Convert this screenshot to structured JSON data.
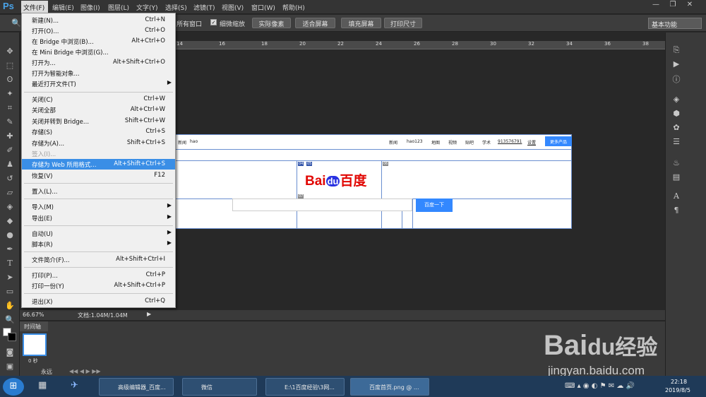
{
  "app": {
    "logo": "Ps"
  },
  "menubar": {
    "items": [
      "文件(F)",
      "编辑(E)",
      "图像(I)",
      "图层(L)",
      "文字(Y)",
      "选择(S)",
      "滤镜(T)",
      "视图(V)",
      "窗口(W)",
      "帮助(H)"
    ],
    "window_buttons": [
      "—",
      "❐",
      "✕"
    ]
  },
  "options": {
    "all_windows": "所有窗口",
    "scrubby_zoom": "细微缩放",
    "btn_actual": "实际像素",
    "btn_fit": "适合屏幕",
    "btn_fill": "填充屏幕",
    "btn_print": "打印尺寸",
    "workspace": "基本功能"
  },
  "file_menu": {
    "items": [
      {
        "label": "新建(N)...",
        "shortcut": "Ctrl+N"
      },
      {
        "label": "打开(O)...",
        "shortcut": "Ctrl+O"
      },
      {
        "label": "在 Bridge 中浏览(B)...",
        "shortcut": "Alt+Ctrl+O"
      },
      {
        "label": "在 Mini Bridge 中浏览(G)...",
        "shortcut": ""
      },
      {
        "label": "打开为...",
        "shortcut": "Alt+Shift+Ctrl+O"
      },
      {
        "label": "打开为智能对象...",
        "shortcut": ""
      },
      {
        "label": "最近打开文件(T)",
        "shortcut": ""
      },
      {
        "label": "关闭(C)",
        "shortcut": "Ctrl+W"
      },
      {
        "label": "关闭全部",
        "shortcut": "Alt+Ctrl+W"
      },
      {
        "label": "关闭并转到 Bridge...",
        "shortcut": "Shift+Ctrl+W"
      },
      {
        "label": "存储(S)",
        "shortcut": "Ctrl+S"
      },
      {
        "label": "存储为(A)...",
        "shortcut": "Shift+Ctrl+S"
      },
      {
        "label": "签入(I)...",
        "shortcut": ""
      },
      {
        "label": "存储为 Web 所用格式...",
        "shortcut": "Alt+Shift+Ctrl+S"
      },
      {
        "label": "恢复(V)",
        "shortcut": "F12"
      },
      {
        "label": "置入(L)...",
        "shortcut": ""
      },
      {
        "label": "导入(M)",
        "shortcut": ""
      },
      {
        "label": "导出(E)",
        "shortcut": ""
      },
      {
        "label": "自动(U)",
        "shortcut": ""
      },
      {
        "label": "脚本(R)",
        "shortcut": ""
      },
      {
        "label": "文件简介(F)...",
        "shortcut": "Alt+Shift+Ctrl+I"
      },
      {
        "label": "打印(P)...",
        "shortcut": "Ctrl+P"
      },
      {
        "label": "打印一份(Y)",
        "shortcut": "Alt+Shift+Ctrl+P"
      },
      {
        "label": "退出(X)",
        "shortcut": "Ctrl+Q"
      }
    ]
  },
  "ruler": {
    "top_labels": [
      "14",
      "16",
      "18",
      "20",
      "22",
      "24",
      "26",
      "28",
      "30",
      "32",
      "34",
      "36",
      "38"
    ]
  },
  "canvas": {
    "nav_links": [
      "新闻",
      "hao123",
      "地图",
      "视频",
      "贴吧",
      "学术",
      "913576791",
      "设置"
    ],
    "more_btn": "更多产品",
    "left_links": [
      "新闻",
      "hao"
    ],
    "logo_bai": "Bai",
    "logo_du": "du",
    "logo_cn": "百度",
    "search_btn": "百度一下",
    "slice_tags": [
      "04",
      "05",
      "06",
      "07",
      "08",
      "09"
    ]
  },
  "status": {
    "zoom": "66.67%",
    "doc": "文档:1.04M/1.04M"
  },
  "timeline": {
    "title": "时间轴",
    "frame_time": "0 秒",
    "loop": "永远"
  },
  "taskbar": {
    "items": [
      "高级编辑器_百度...",
      "微信",
      "E:\\1百度经验\\3网...",
      "百度首页.png @ ..."
    ],
    "time": "22:18",
    "date": "2019/8/5"
  },
  "watermark": {
    "text1": "Bai",
    "text2": "du",
    "text3": "经验",
    "url": "jingyan.baidu.com"
  },
  "colors": {
    "accent": "#3a8ee6",
    "baidu_red": "#e10602",
    "baidu_blue": "#2932e1"
  }
}
